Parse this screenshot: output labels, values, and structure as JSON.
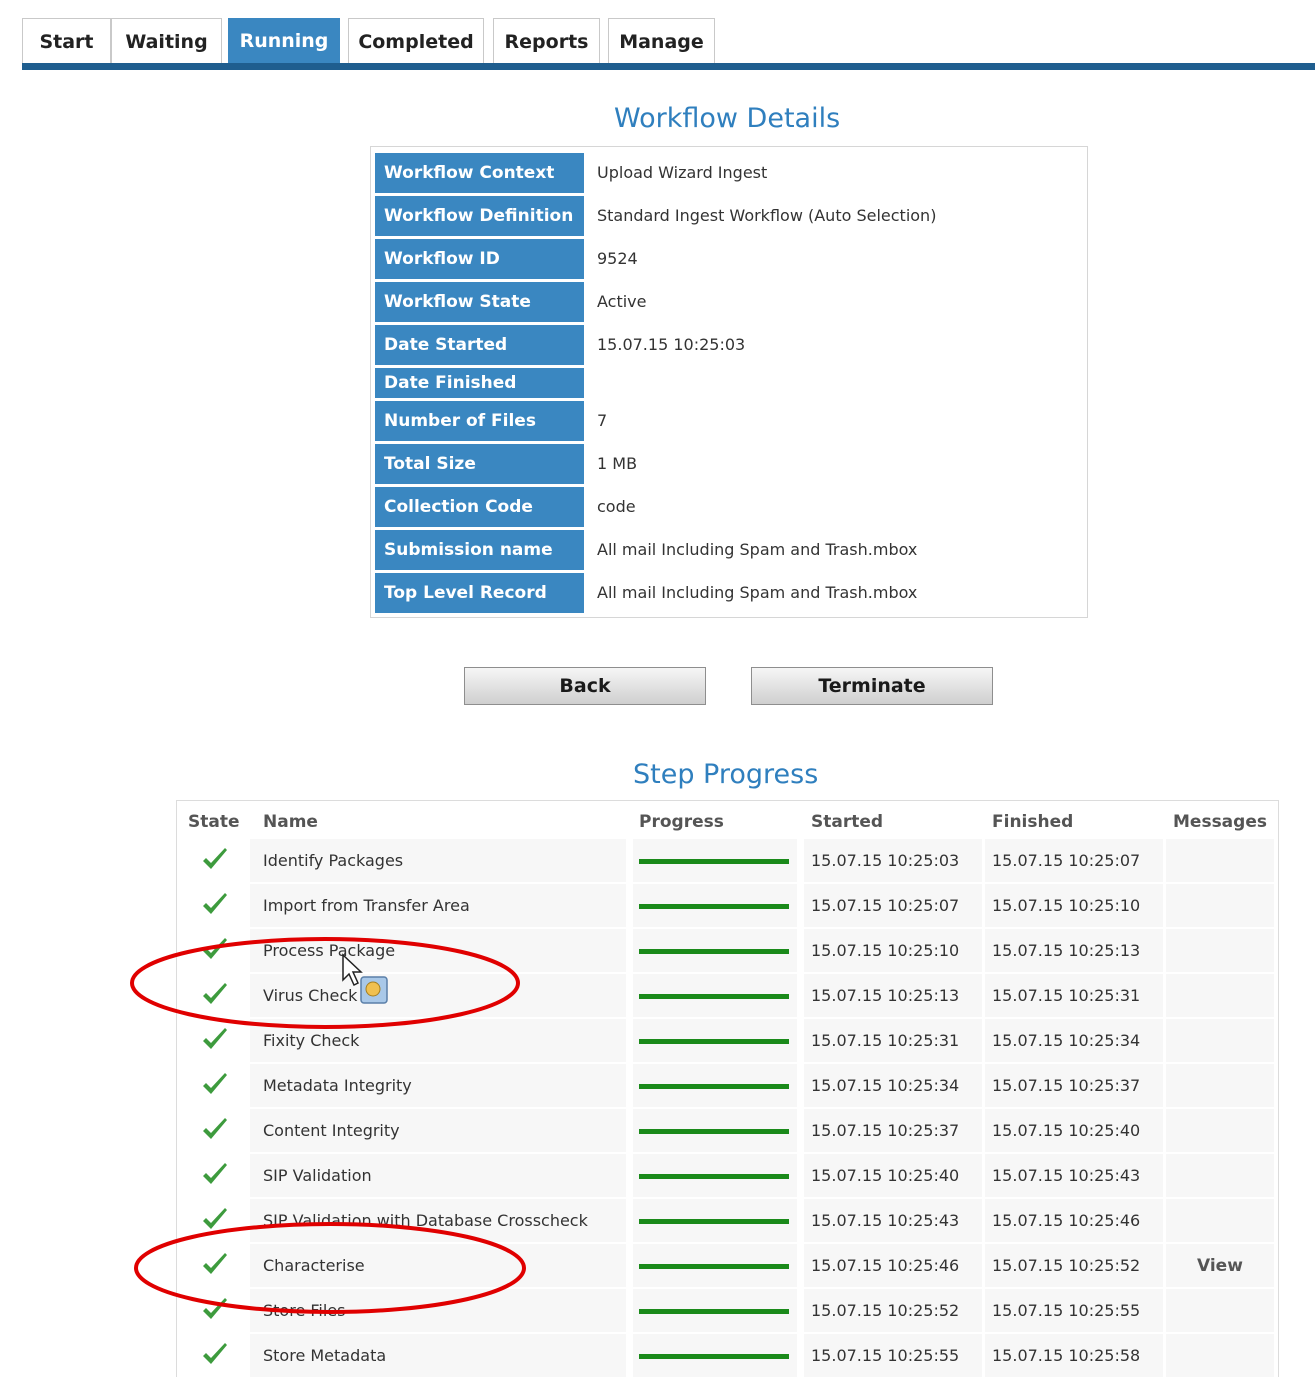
{
  "tabs": [
    {
      "label": "Start",
      "active": false
    },
    {
      "label": "Waiting",
      "active": false
    },
    {
      "label": "Running",
      "active": true
    },
    {
      "label": "Completed",
      "active": false
    },
    {
      "label": "Reports",
      "active": false
    },
    {
      "label": "Manage",
      "active": false
    }
  ],
  "details": {
    "title": "Workflow Details",
    "rows": [
      {
        "label": "Workflow Context",
        "value": "Upload Wizard Ingest"
      },
      {
        "label": "Workflow Definition",
        "value": "Standard Ingest Workflow (Auto Selection)"
      },
      {
        "label": "Workflow ID",
        "value": "9524"
      },
      {
        "label": "Workflow State",
        "value": "Active"
      },
      {
        "label": "Date Started",
        "value": "15.07.15 10:25:03"
      },
      {
        "label": "Date Finished",
        "value": ""
      },
      {
        "label": "Number of Files",
        "value": "7"
      },
      {
        "label": "Total Size",
        "value": "1 MB"
      },
      {
        "label": "Collection Code",
        "value": "code"
      },
      {
        "label": "Submission name",
        "value": "All mail Including Spam and Trash.mbox"
      },
      {
        "label": "Top Level Record",
        "value": "All mail Including Spam and Trash.mbox"
      }
    ]
  },
  "buttons": {
    "back_label": "Back",
    "terminate_label": "Terminate"
  },
  "steps": {
    "title": "Step Progress",
    "headers": {
      "state": "State",
      "name": "Name",
      "progress": "Progress",
      "started": "Started",
      "finished": "Finished",
      "messages": "Messages"
    },
    "rows": [
      {
        "state_icon": "checkmark-icon",
        "name": "Identify Packages",
        "progress": 1.0,
        "started": "15.07.15 10:25:03",
        "finished": "15.07.15 10:25:07",
        "messages": ""
      },
      {
        "state_icon": "checkmark-icon",
        "name": "Import from Transfer Area",
        "progress": 1.0,
        "started": "15.07.15 10:25:07",
        "finished": "15.07.15 10:25:10",
        "messages": ""
      },
      {
        "state_icon": "checkmark-icon",
        "name": "Process Package",
        "progress": 1.0,
        "started": "15.07.15 10:25:10",
        "finished": "15.07.15 10:25:13",
        "messages": ""
      },
      {
        "state_icon": "checkmark-icon",
        "name": "Virus Check",
        "progress": 1.0,
        "started": "15.07.15 10:25:13",
        "finished": "15.07.15 10:25:31",
        "messages": ""
      },
      {
        "state_icon": "checkmark-icon",
        "name": "Fixity Check",
        "progress": 1.0,
        "started": "15.07.15 10:25:31",
        "finished": "15.07.15 10:25:34",
        "messages": ""
      },
      {
        "state_icon": "checkmark-icon",
        "name": "Metadata Integrity",
        "progress": 1.0,
        "started": "15.07.15 10:25:34",
        "finished": "15.07.15 10:25:37",
        "messages": ""
      },
      {
        "state_icon": "checkmark-icon",
        "name": "Content Integrity",
        "progress": 1.0,
        "started": "15.07.15 10:25:37",
        "finished": "15.07.15 10:25:40",
        "messages": ""
      },
      {
        "state_icon": "checkmark-icon",
        "name": "SIP Validation",
        "progress": 1.0,
        "started": "15.07.15 10:25:40",
        "finished": "15.07.15 10:25:43",
        "messages": ""
      },
      {
        "state_icon": "checkmark-icon",
        "name": "SIP Validation with Database Crosscheck",
        "progress": 1.0,
        "started": "15.07.15 10:25:43",
        "finished": "15.07.15 10:25:46",
        "messages": ""
      },
      {
        "state_icon": "checkmark-icon",
        "name": "Characterise",
        "progress": 1.0,
        "started": "15.07.15 10:25:46",
        "finished": "15.07.15 10:25:52",
        "messages": "View"
      },
      {
        "state_icon": "checkmark-icon",
        "name": "Store Files",
        "progress": 1.0,
        "started": "15.07.15 10:25:52",
        "finished": "15.07.15 10:25:55",
        "messages": ""
      },
      {
        "state_icon": "checkmark-icon",
        "name": "Store Metadata",
        "progress": 1.0,
        "started": "15.07.15 10:25:55",
        "finished": "15.07.15 10:25:58",
        "messages": ""
      }
    ]
  },
  "colors": {
    "tab_active_bg": "#3a87c1",
    "tab_underline": "#1f5e8f",
    "label_bg": "#3a87c1",
    "heading_text": "#2f7fbe",
    "progress_fill": "#1a8a1a",
    "check_green": "#3d9b3d",
    "annotation_red": "#e00000"
  }
}
